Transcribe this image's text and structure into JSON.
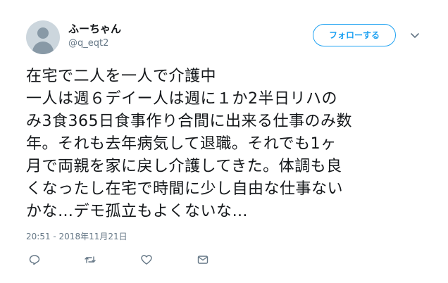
{
  "user": {
    "display_name": "ふーちゃん",
    "handle": "@q_eqt2",
    "avatar_icon": "default-user-silhouette"
  },
  "header": {
    "follow_label": "フォローする",
    "menu_icon": "chevron-down-icon"
  },
  "tweet": {
    "text": "在宅で二人を一人で介護中\n一人は週６デイー人は週に１か2半日リハの\nみ3食365日食事作り合間に出来る仕事のみ数\n年。それも去年病気して退職。それでも1ヶ\n月で両親を家に戻し介護してきた。体調も良\nくなったし在宅で時間に少し自由な仕事ない\nかな…デモ孤立もよくないな…",
    "timestamp": "20:51 - 2018年11月21日"
  },
  "actions": [
    {
      "name": "reply",
      "icon": "reply-icon"
    },
    {
      "name": "retweet",
      "icon": "retweet-icon"
    },
    {
      "name": "like",
      "icon": "heart-icon"
    },
    {
      "name": "message",
      "icon": "mail-icon"
    }
  ],
  "colors": {
    "accent": "#1da1f2",
    "text": "#14171a",
    "secondary": "#657786",
    "avatar_bg": "#ccd6dd"
  }
}
